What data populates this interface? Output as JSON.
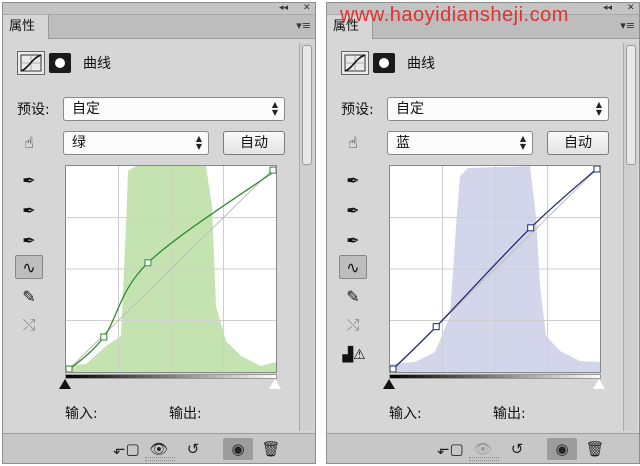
{
  "watermark": "www.haoyidiansheji.com",
  "panels": [
    {
      "tab": "属性",
      "title": "曲线",
      "preset_label": "预设:",
      "preset_value": "自定",
      "channel_value": "绿",
      "auto_button": "自动",
      "input_label": "输入:",
      "output_label": "输出:",
      "histogram_color": "#c5e3b0",
      "curve_color": "#2f8a2f",
      "curve_points": [
        [
          0,
          0
        ],
        [
          0.18,
          0.17
        ],
        [
          0.39,
          0.53
        ],
        [
          1,
          0.98
        ]
      ]
    },
    {
      "tab": "属性",
      "title": "曲线",
      "preset_label": "预设:",
      "preset_value": "自定",
      "channel_value": "蓝",
      "auto_button": "自动",
      "input_label": "输入:",
      "output_label": "输出:",
      "histogram_color": "#d3d5ea",
      "curve_color": "#1f2a6e",
      "curve_points": [
        [
          0,
          0
        ],
        [
          0.22,
          0.22
        ],
        [
          0.67,
          0.7
        ],
        [
          1,
          1
        ]
      ]
    }
  ],
  "icons": {
    "curves_tool": "curves-icon",
    "mask": "mask-icon",
    "targeted_adjustment": "hand-icon",
    "eyedroppers": [
      "black-point-eyedropper-icon",
      "gray-point-eyedropper-icon",
      "white-point-eyedropper-icon"
    ],
    "edit_points": "curve-edit-icon",
    "draw": "pencil-icon",
    "smooth": "smooth-icon",
    "clipping_warning": "clipping-warning-icon",
    "bottom": [
      "clip-to-layer-icon",
      "view-previous-icon",
      "reset-icon",
      "visibility-icon",
      "delete-icon"
    ]
  }
}
